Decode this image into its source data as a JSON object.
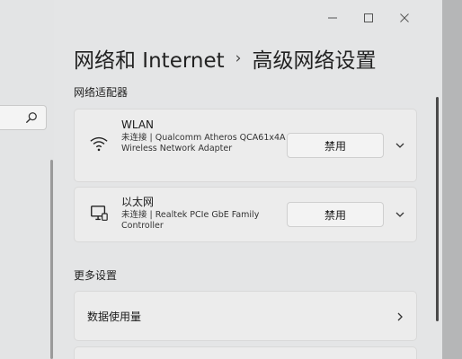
{
  "sidebar": {
    "search": {
      "icon": "search-icon"
    }
  },
  "window": {
    "controls": [
      "minimize-icon",
      "maximize-icon",
      "close-icon"
    ]
  },
  "header": {
    "parent": "网络和 Internet",
    "separator": "›",
    "current": "高级网络设置"
  },
  "adapters": {
    "section_label": "网络适配器",
    "items": [
      {
        "icon": "wifi-icon",
        "name": "WLAN",
        "desc": "未连接 | Qualcomm Atheros QCA61x4A Wireless Network Adapter",
        "button": "禁用"
      },
      {
        "icon": "ethernet-icon",
        "name": "以太网",
        "desc": "未连接 | Realtek PCIe GbE Family Controller",
        "button": "禁用"
      }
    ]
  },
  "more": {
    "section_label": "更多设置",
    "items": [
      {
        "label": "数据使用量"
      }
    ]
  }
}
